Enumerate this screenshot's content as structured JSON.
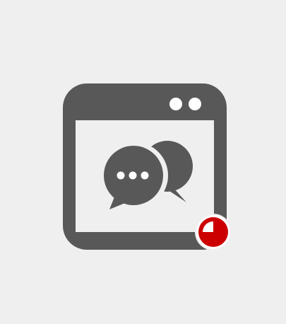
{
  "icon": {
    "name": "chat-window-icon",
    "description_hidden": "",
    "colors": {
      "background": "#efefef",
      "window": "#585858",
      "window_inner": "#efefef",
      "bubble_front": "#585858",
      "bubble_back": "#585858",
      "dots": "#ffffff",
      "window_buttons": "#ffffff",
      "badge_fill": "#cc0000",
      "badge_ring": "#ffffff",
      "badge_quadrant": "#ffffff"
    },
    "badge": {
      "name": "timer-badge-icon",
      "progress": 0.25
    }
  }
}
